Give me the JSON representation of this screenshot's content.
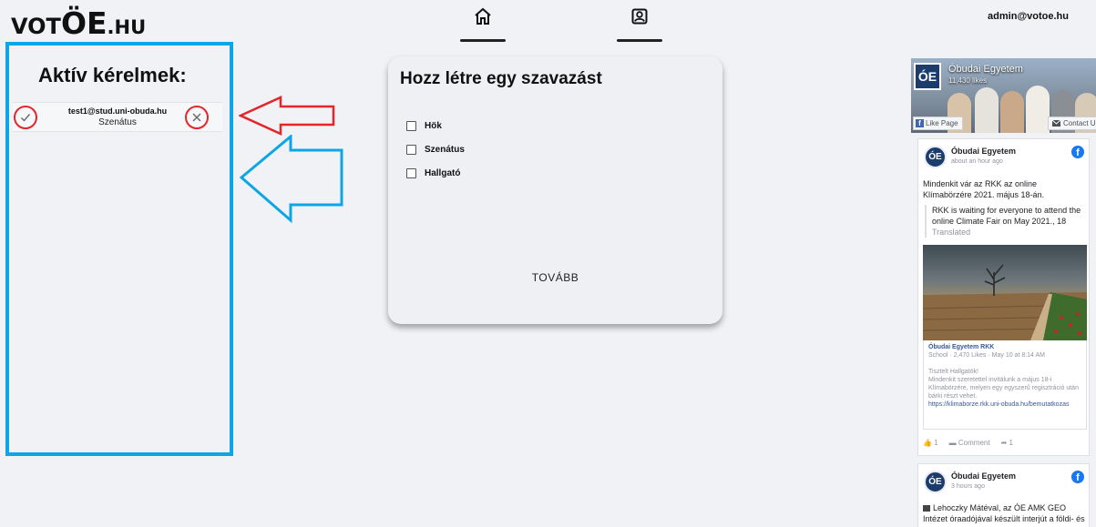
{
  "logo": {
    "part1": "VOT",
    "part2": "ÖE",
    "part3": ".HU"
  },
  "header": {
    "nav": [
      {
        "icon": "home-icon"
      },
      {
        "icon": "profile-icon"
      }
    ],
    "user_email": "admin@votoe.hu"
  },
  "requests": {
    "title": "Aktív kérelmek:",
    "items": [
      {
        "email": "test1@stud.uni-obuda.hu",
        "role": "Szenátus",
        "accept_icon": "check-icon",
        "reject_icon": "close-icon"
      }
    ]
  },
  "annotations": {
    "red_arrow_color": "#e3262c",
    "blue_arrow_color": "#0ea5e6"
  },
  "vote": {
    "title": "Hozz létre egy szavazást",
    "options": [
      {
        "label": "Hök",
        "checked": false
      },
      {
        "label": "Szenátus",
        "checked": false
      },
      {
        "label": "Hallgató",
        "checked": false
      }
    ],
    "continue_label": "TOVÁBB"
  },
  "facebook": {
    "page_name": "Óbudai Egyetem",
    "likes": "11,430 likes",
    "logo_text": "ÓE",
    "like_page_label": "Like Page",
    "contact_label": "Contact Us",
    "posts": [
      {
        "author": "Óbudai Egyetem",
        "time": "about an hour ago",
        "text": "Mindenkit vár az RKK az online Klímabörzére 2021. május 18-án.",
        "translation": "RKK is waiting for everyone to attend the online Climate Fair on May 2021., 18",
        "translated_label": "Translated",
        "shared": {
          "name": "Óbudai Egyetem RKK",
          "meta": "School · 2,470 Likes · May 10 at 8:14 AM",
          "body_1": "Tisztelt Hallgatók!",
          "body_2": "Mindenkit szeretettel invitálunk a május 18-i Klímabörzére, melyen egy egyszerű regisztráció után bárki részt vehet.",
          "link": "https://klimaborze.rkk.uni-obuda.hu/bemutatkozas"
        },
        "likes": "1",
        "comment_label": "Comment",
        "shares": "1"
      },
      {
        "author": "Óbudai Egyetem",
        "time": "3 hours ago",
        "text": "Lehoczky Mátéval, az ÓE AMK GEO Intézet óraadójával készült interjút a földi- és"
      }
    ]
  }
}
